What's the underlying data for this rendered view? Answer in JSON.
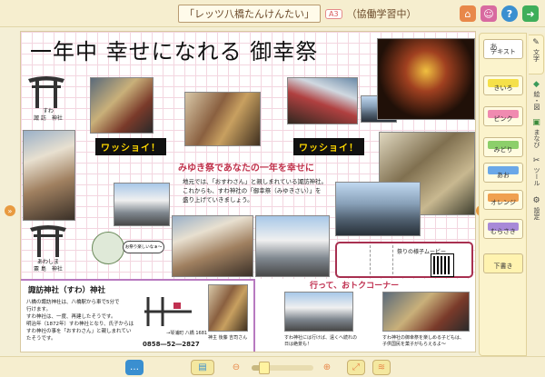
{
  "topbar": {
    "title": "「レッツ八橋たんけんたい」",
    "badge": "A3",
    "status": "（協働学習中）",
    "icons": [
      "home-icon",
      "users-icon",
      "help-icon",
      "exit-icon"
    ]
  },
  "canvas": {
    "headline": "一年中 幸せになれる 御幸祭",
    "torii1_label": [
      "すわ",
      "諏 訪　神社"
    ],
    "torii2_label": [
      "あわしま",
      "粟 島　神社"
    ],
    "wasshoi": "ワッショイ！",
    "red_heading": "みゆき祭であなたの一年を幸せに",
    "body_lines": [
      "地元では、「おすわさん」と親しまれている諏訪神社。",
      "これからも、すわ神社の「御幸祭（みゆきさい）」を",
      "盛り上げていきましょう。"
    ],
    "bubble": "お祭り楽しいなぁ～",
    "movie_title": "祭りの様子ムービー",
    "shrine": {
      "heading": "諏訪神社（すわ）神社",
      "text": [
        "八橋の諏訪神社は、八橋駅から車で5分で",
        "行けます。",
        "すわ神社は、一度、再建したそうです。",
        "明治年（1872年）すわ神社となり、氏子からは",
        "すわ神社の事を「おすわさん」と親しまれてい",
        "たそうです。"
      ],
      "address": "→琴浦町 八橋 1681",
      "phone": "0858―52―2827",
      "caption": "神主 後藤 吉司さん"
    },
    "corner": {
      "heading": "行って、おトクコーナー",
      "cap1": [
        "すわ神社には行けば、遠くへ続れの",
        "日は絶景も！"
      ],
      "cap2": [
        "すわ神社の御幸祭を楽しめる子どもは、",
        "子供国民を菓子がもらえるよ～"
      ]
    }
  },
  "sidebar": {
    "tools": [
      {
        "label": "テキスト",
        "color": "#ffffff",
        "icon": "text-icon"
      },
      {
        "label": "きいろ",
        "color": "#f5e04a"
      },
      {
        "label": "ピンク",
        "color": "#f08ab0"
      },
      {
        "label": "みどり",
        "color": "#8ccf6a"
      },
      {
        "label": "あお",
        "color": "#6aa8e8"
      },
      {
        "label": "オレンジ",
        "color": "#f0a050"
      },
      {
        "label": "むらさき",
        "color": "#a88ad8"
      },
      {
        "label": "下書き",
        "color": "#fff3b0"
      }
    ]
  },
  "tabs": [
    {
      "label": "文字",
      "icon": "pencil-icon",
      "active": true
    },
    {
      "label": "絵・図",
      "icon": "shapes-icon"
    },
    {
      "label": "まなび",
      "icon": "book-icon"
    },
    {
      "label": "ツール",
      "icon": "wrench-icon"
    },
    {
      "label": "設定",
      "icon": "gear-icon"
    }
  ],
  "bottombar": {
    "zoom_level": 0.18
  }
}
